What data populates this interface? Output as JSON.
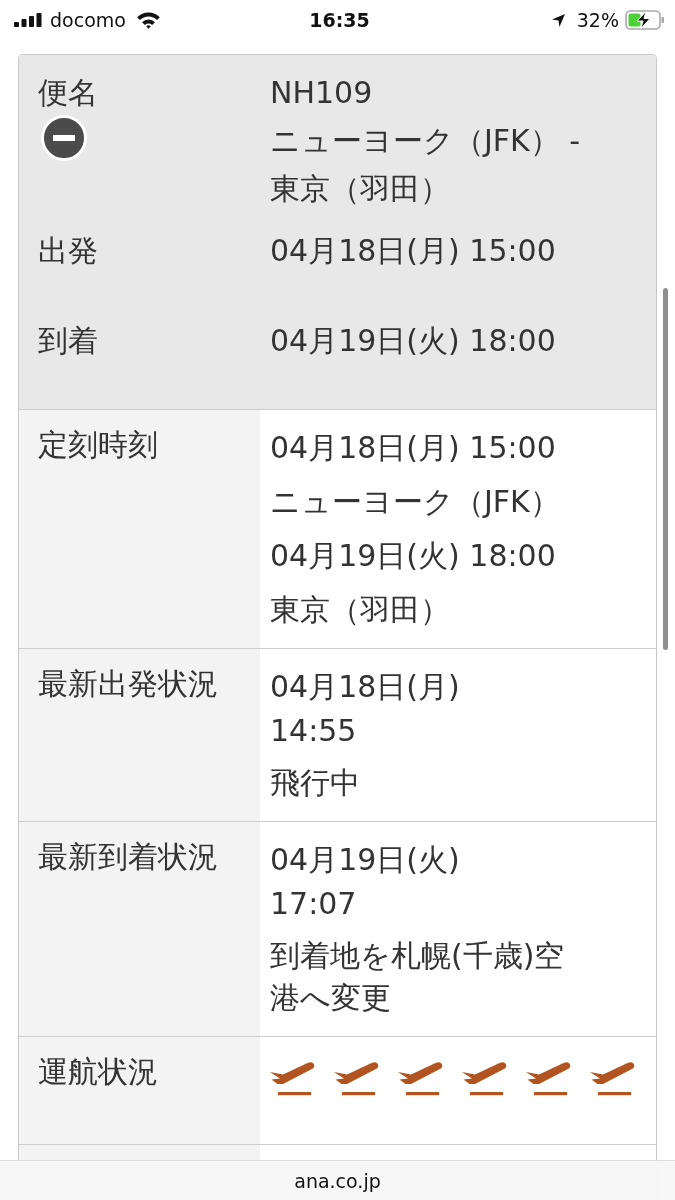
{
  "status_bar": {
    "carrier": "docomo",
    "time": "16:35",
    "location_active": true,
    "battery": "32%",
    "charging": true
  },
  "flight_header": {
    "expanded": true,
    "rows": [
      {
        "label": "便名",
        "values": [
          "NH109",
          "ニューヨーク（JFK） - 東京（羽田）"
        ]
      },
      {
        "label": "出発",
        "values": [
          "04月18日(月) 15:00"
        ]
      },
      {
        "label": "到着",
        "values": [
          "04月19日(火) 18:00"
        ]
      }
    ]
  },
  "details": [
    {
      "kind": "schedule",
      "label": "定刻時刻",
      "lines": [
        "04月18日(月) 15:00",
        "ニューヨーク（JFK）",
        "04月19日(火) 18:00",
        "東京（羽田）"
      ]
    },
    {
      "kind": "status",
      "label": "最新出発状況",
      "lines": [
        "04月18日(月)",
        "14:55"
      ],
      "note": "飛行中"
    },
    {
      "kind": "status",
      "label": "最新到着状況",
      "lines": [
        "04月19日(火)",
        "17:07"
      ],
      "note": "到着地を札幌(千歳)空港へ変更"
    },
    {
      "kind": "icons",
      "label": "運航状況",
      "icons": [
        {
          "kind": "takeoff"
        },
        {
          "kind": "takeoff"
        },
        {
          "kind": "takeoff"
        },
        {
          "kind": "takeoff"
        },
        {
          "kind": "takeoff"
        },
        {
          "kind": "takeoff"
        }
      ]
    }
  ],
  "address_bar": {
    "domain": "ana.co.jp"
  }
}
